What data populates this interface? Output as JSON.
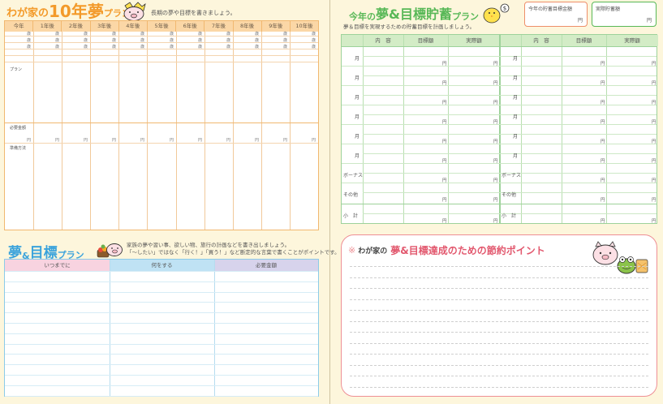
{
  "ten_year": {
    "title_a": "わが家の",
    "title_b": "10年夢",
    "title_c": "プラン",
    "description": "長期の夢や目標を書きましょう。",
    "columns": [
      "今年",
      "1年後",
      "2年後",
      "3年後",
      "4年後",
      "5年後",
      "6年後",
      "7年後",
      "8年後",
      "9年後",
      "10年後"
    ],
    "age_unit": "歳",
    "plan_label": "プラン",
    "required_label": "必要金額",
    "yen": "円",
    "method_label": "準備方法"
  },
  "dream_goal": {
    "title_a": "夢",
    "title_amp": "&",
    "title_b": "目標",
    "title_c": "プラン",
    "desc_line1": "家族の夢や習い事、欲しい物、旅行の計画などを書き出しましょう。",
    "desc_line2": "「～したい」ではなく「行く！」「買う！」など断定的な言葉で書くことがポイントです。",
    "col_when": "いつまでに",
    "col_what": "何をする",
    "col_amount": "必要金額"
  },
  "savings": {
    "title_a": "今年の",
    "title_b": "夢&目標貯蓄",
    "title_c": "プラン",
    "description": "夢＆目標を実現するための貯蓄目標を計画しましょう。",
    "goal_label": "今年の貯蓄目標金額",
    "actual_label": "実際貯蓄額",
    "yen": "円",
    "col_content": "内　容",
    "col_target": "目標額",
    "col_actual": "実際額",
    "month": "月",
    "bonus": "ボーナス",
    "other": "その他",
    "subtotal": "小　計"
  },
  "points": {
    "star": "※",
    "title_a": "わが家の",
    "title_b": "夢&目標達成のための節約ポイント"
  },
  "colors": {
    "orange": "#f39a2a",
    "blue": "#3aa3dc",
    "green": "#58b857",
    "pink": "#e2586e"
  }
}
